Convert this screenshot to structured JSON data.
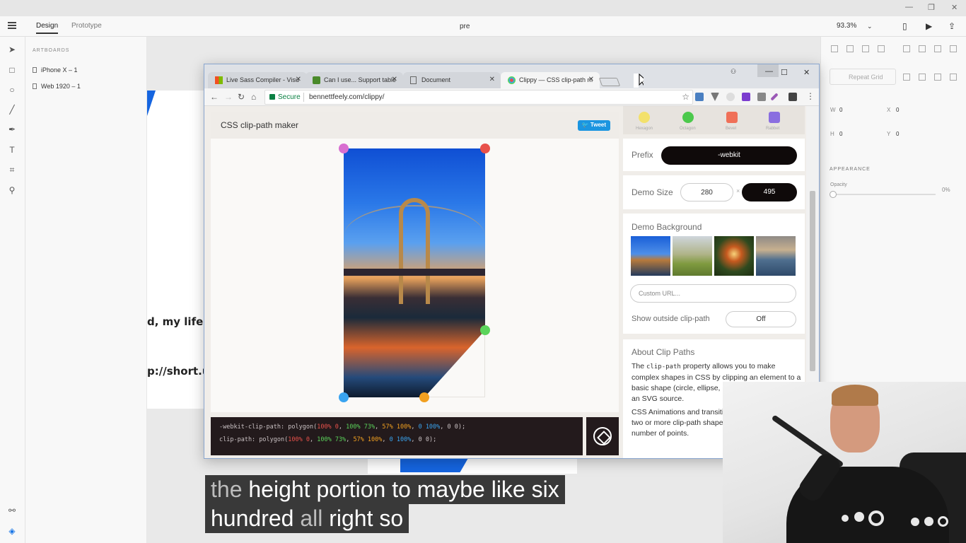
{
  "xd": {
    "tabs": {
      "design": "Design",
      "prototype": "Prototype"
    },
    "doc_title": "pre",
    "zoom": "93.3%",
    "layers": {
      "title": "ARTBOARDS",
      "items": [
        {
          "label": "iPhone X – 1"
        },
        {
          "label": "Web 1920 – 1"
        }
      ]
    },
    "artboard_text": {
      "line1": "d, my life is",
      "line2": "p://short.url"
    },
    "props": {
      "repeat_grid": "Repeat Grid",
      "w_label": "W",
      "w_value": "0",
      "h_label": "H",
      "h_value": "0",
      "x_label": "X",
      "x_value": "0",
      "y_label": "Y",
      "y_value": "0",
      "appearance": "APPEARANCE",
      "opacity_label": "Opacity",
      "opacity_value": "0%"
    }
  },
  "browser": {
    "tabs": [
      {
        "title": "Live Sass Compiler - Visu",
        "icon": "windows-logo-icon"
      },
      {
        "title": "Can I use... Support table",
        "icon": "caniuse-icon"
      },
      {
        "title": "Document",
        "icon": "page-icon"
      },
      {
        "title": "Clippy — CSS clip-path m",
        "icon": "clippy-icon",
        "active": true
      }
    ],
    "secure_label": "Secure",
    "url": "bennettfeely.com/clippy/"
  },
  "clippy": {
    "title": "CSS clip-path maker",
    "tweet": "Tweet",
    "shapes": [
      "Hexagon",
      "Octagon",
      "Bevel",
      "Rabbet"
    ],
    "prefix_label": "Prefix",
    "prefix_value": "-webkit",
    "demo_size_label": "Demo Size",
    "demo_width": "280",
    "times": "×",
    "demo_height": "495",
    "demo_bg_label": "Demo Background",
    "custom_url_placeholder": "Custom URL...",
    "show_outside_label": "Show outside clip-path",
    "show_outside_value": "Off",
    "about_title": "About Clip Paths",
    "about_p1_a": "The",
    "about_p1_code": "clip-path",
    "about_p1_b": "property allows you to make complex shapes in CSS by clipping an element to a basic shape (circle, ellipse, polygon, or inset), or to an SVG source.",
    "about_p2": "CSS Animations and transitions are possible with two or more clip-path shapes with the same number of points.",
    "code": {
      "line1_prop": "-webkit-clip-path:",
      "line2_prop": "clip-path:",
      "fn_open": "polygon(",
      "p1": "100% 0",
      "p2": "100% 73%",
      "p3": "57% 100%",
      "p4": "0 100%",
      "p5": "0 0",
      "comma": ", ",
      "fn_close": ");"
    },
    "colors": {
      "p1": "#e8514b",
      "p2": "#5bd45b",
      "p3": "#f1a020",
      "p4": "#39a4f0",
      "p5": "#d86fd0"
    }
  },
  "captions": {
    "line1_faded": "the",
    "line1_rest": "height portion to maybe like six",
    "line2_a": "hundred",
    "line2_faded": "all",
    "line2_b": "right so"
  }
}
